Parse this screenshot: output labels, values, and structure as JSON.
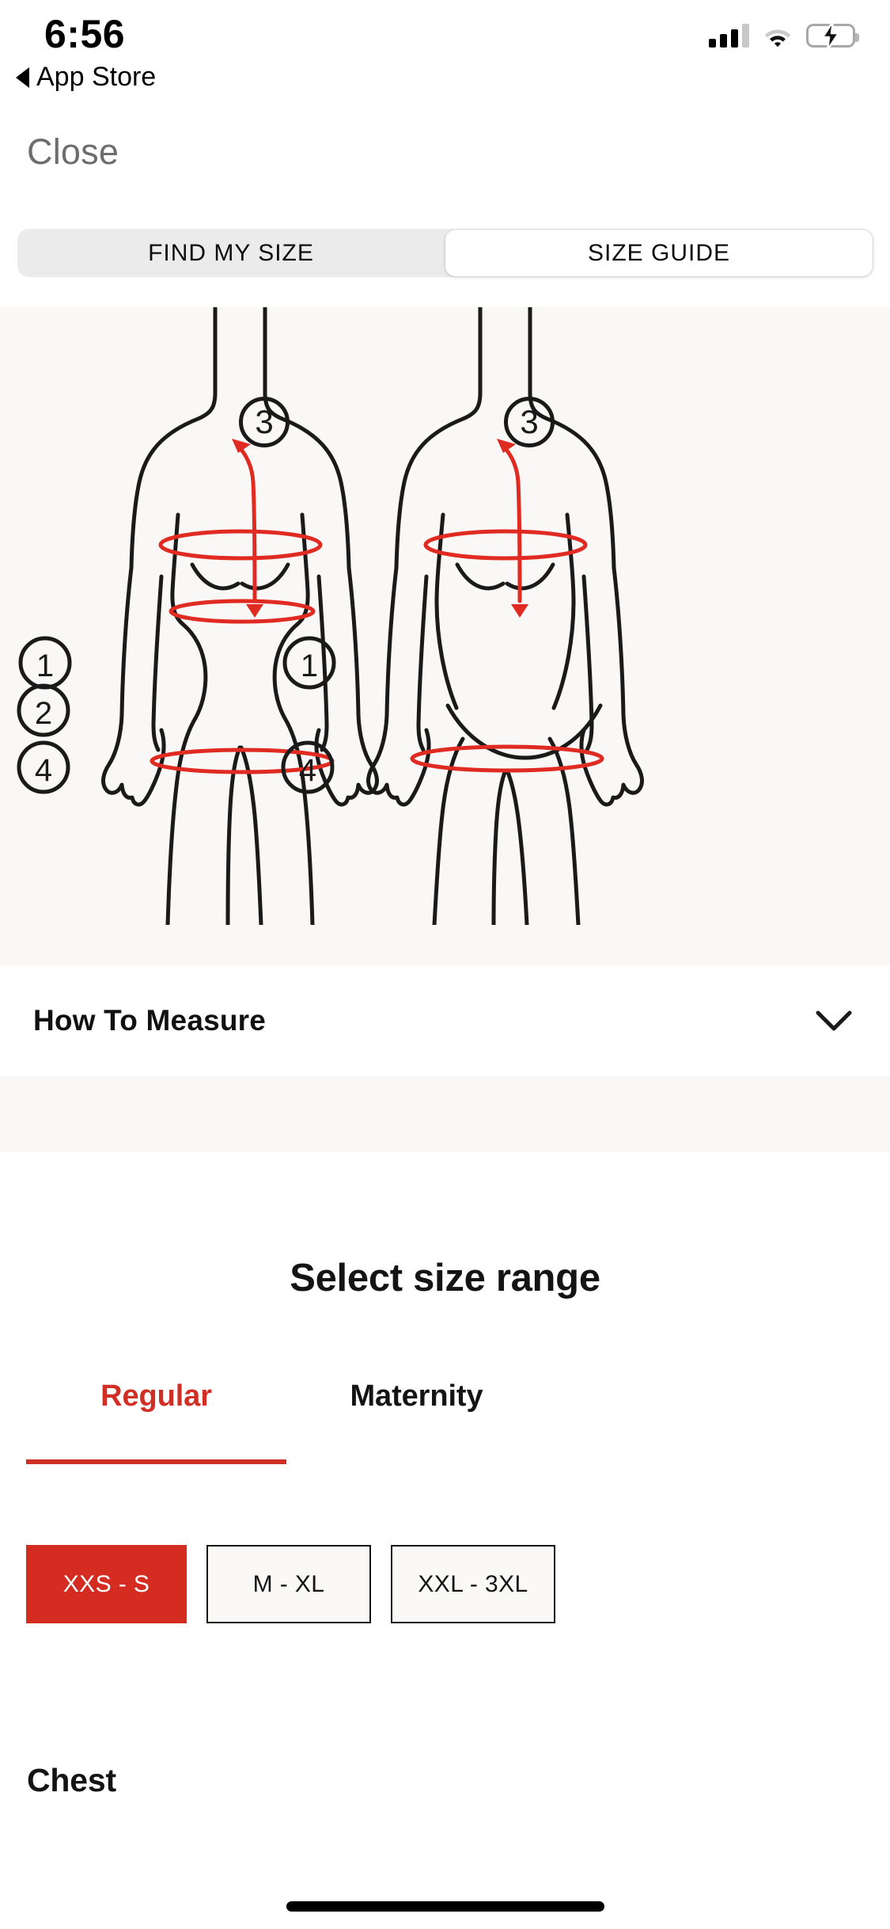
{
  "status_bar": {
    "time": "6:56",
    "return_label": "App Store",
    "back_triangle_icon": "triangle-left-icon",
    "cellular_icon": "cellular-signal-icon",
    "cellular_bars_filled": 3,
    "cellular_bars_total": 4,
    "wifi_icon": "wifi-icon",
    "battery_icon": "battery-charging-icon",
    "battery_color": "#4cd56a"
  },
  "nav": {
    "close_label": "Close"
  },
  "segmented_control": {
    "tabs": [
      {
        "label": "FIND MY SIZE",
        "selected": false
      },
      {
        "label": "SIZE GUIDE",
        "selected": true
      }
    ]
  },
  "illustration": {
    "panel_background": "#f9f8f6",
    "outline_color": "#1a1a1a",
    "measure_color": "#e02b23",
    "figures": [
      {
        "name": "regular-body-figure",
        "markers": [
          {
            "number": "1",
            "measure": "chest"
          },
          {
            "number": "2",
            "measure": "waist"
          },
          {
            "number": "3",
            "measure": "arm-length"
          },
          {
            "number": "4",
            "measure": "hips"
          }
        ]
      },
      {
        "name": "maternity-body-figure",
        "markers": [
          {
            "number": "1",
            "measure": "chest"
          },
          {
            "number": "3",
            "measure": "arm-length"
          },
          {
            "number": "4",
            "measure": "hips"
          }
        ]
      }
    ]
  },
  "how_to_measure": {
    "label": "How To Measure",
    "chevron_icon": "chevron-down-icon",
    "expanded": false
  },
  "size_range": {
    "title": "Select size range",
    "tabs": [
      {
        "label": "Regular",
        "selected": true
      },
      {
        "label": "Maternity",
        "selected": false
      }
    ],
    "accent_color": "#cf2f25",
    "options": [
      {
        "label": "XXS - S",
        "selected": true
      },
      {
        "label": "M - XL",
        "selected": false
      },
      {
        "label": "XXL - 3XL",
        "selected": false
      }
    ]
  },
  "measurement_section": {
    "heading": "Chest"
  },
  "home_indicator": "home-indicator"
}
